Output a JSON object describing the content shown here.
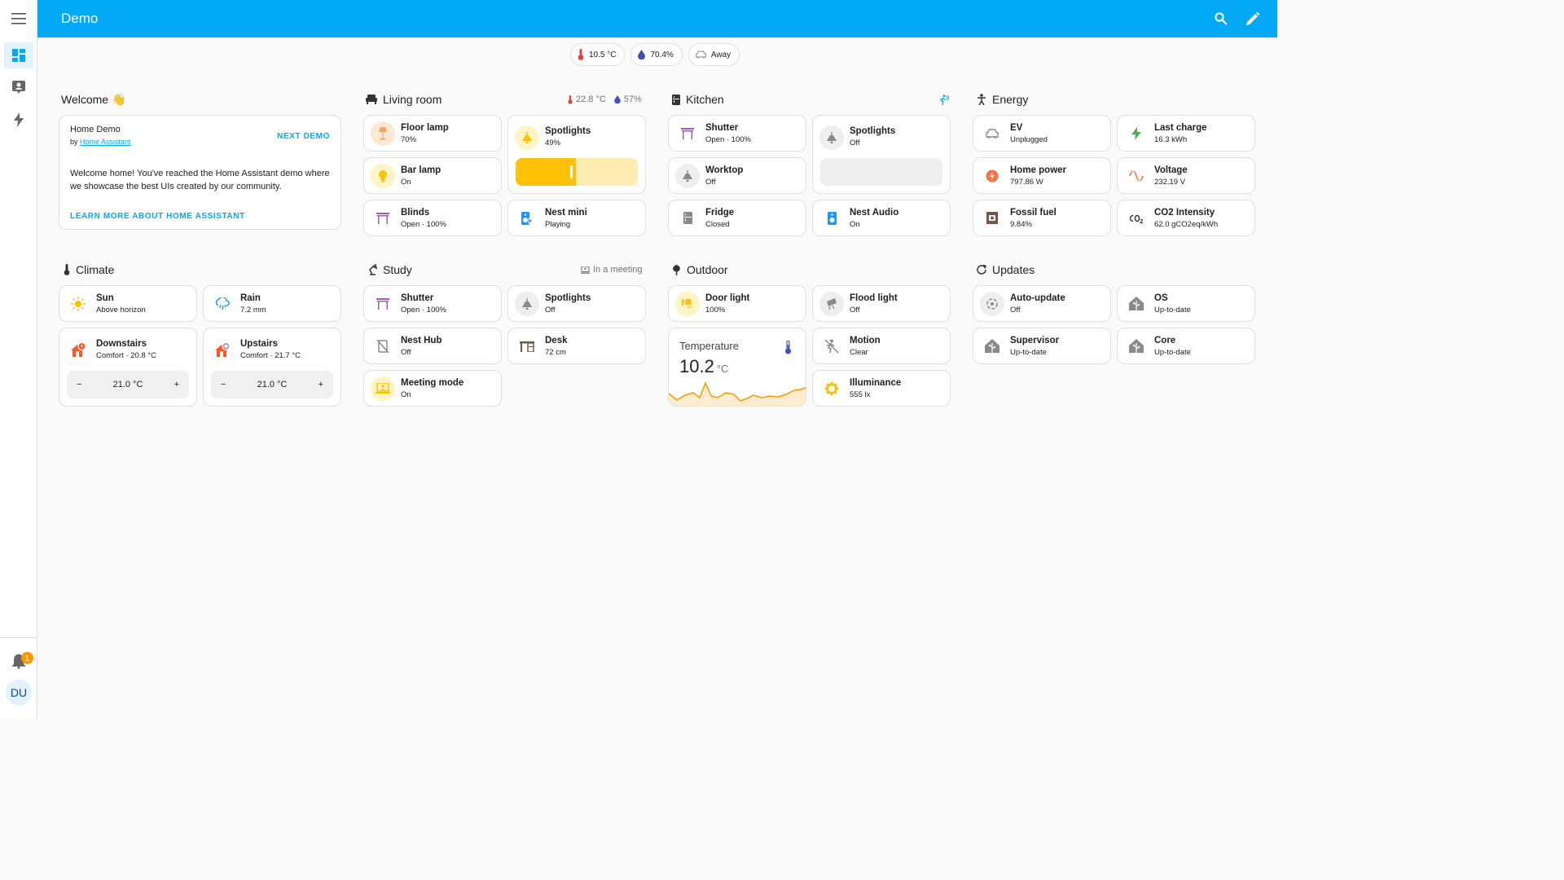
{
  "app": {
    "title": "Demo"
  },
  "sidebar": {
    "user_initials": "DU",
    "notification_count": "1"
  },
  "badges": [
    {
      "label": "10.5 °C",
      "icon": "thermometer-icon",
      "color": "#db4437"
    },
    {
      "label": "70.4%",
      "icon": "water-percent-icon",
      "color": "#3f51b5"
    },
    {
      "label": "Away",
      "icon": "car-icon",
      "color": "#9e9e9e"
    }
  ],
  "sections": {
    "welcome": {
      "title": "Welcome 👋"
    },
    "living_room": {
      "title": "Living room",
      "temp": "22.8 °C",
      "humidity": "57%"
    },
    "kitchen": {
      "title": "Kitchen"
    },
    "energy": {
      "title": "Energy"
    },
    "climate": {
      "title": "Climate"
    },
    "study": {
      "title": "Study",
      "status": "In a meeting"
    },
    "outdoor": {
      "title": "Outdoor"
    },
    "updates": {
      "title": "Updates"
    }
  },
  "welcome_card": {
    "title": "Home Demo",
    "by": "by ",
    "author": "Home Assistant",
    "next_demo": "NEXT DEMO",
    "body": "Welcome home! You've reached the Home Assistant demo where we showcase the best UIs created by our community.",
    "learn_more": "LEARN MORE ABOUT HOME ASSISTANT"
  },
  "living_room": {
    "floor_lamp": {
      "name": "Floor lamp",
      "state": "70%"
    },
    "spotlights": {
      "name": "Spotlights",
      "state": "49%",
      "level": 0.49
    },
    "bar_lamp": {
      "name": "Bar lamp",
      "state": "On"
    },
    "blinds": {
      "name": "Blinds",
      "state": "Open · 100%"
    },
    "nest_mini": {
      "name": "Nest mini",
      "state": "Playing"
    }
  },
  "kitchen": {
    "shutter": {
      "name": "Shutter",
      "state": "Open · 100%"
    },
    "spotlights": {
      "name": "Spotlights",
      "state": "Off"
    },
    "worktop": {
      "name": "Worktop",
      "state": "Off"
    },
    "fridge": {
      "name": "Fridge",
      "state": "Closed"
    },
    "nest_audio": {
      "name": "Nest Audio",
      "state": "On"
    }
  },
  "energy": {
    "ev": {
      "name": "EV",
      "state": "Unplugged"
    },
    "last_charge": {
      "name": "Last charge",
      "state": "16.3 kWh"
    },
    "home_power": {
      "name": "Home power",
      "state": "797.86 W"
    },
    "voltage": {
      "name": "Voltage",
      "state": "232.19 V"
    },
    "fossil_fuel": {
      "name": "Fossil fuel",
      "state": "9.84%"
    },
    "co2": {
      "name": "CO2 Intensity",
      "state": "62.0 gCO2eq/kWh"
    }
  },
  "climate": {
    "sun": {
      "name": "Sun",
      "state": "Above horizon"
    },
    "rain": {
      "name": "Rain",
      "state": "7.2 mm"
    },
    "downstairs": {
      "name": "Downstairs",
      "state": "Comfort · 20.8 °C",
      "target": "21.0 °C"
    },
    "upstairs": {
      "name": "Upstairs",
      "state": "Comfort · 21.7 °C",
      "target": "21.0 °C"
    }
  },
  "study": {
    "shutter": {
      "name": "Shutter",
      "state": "Open · 100%"
    },
    "spotlights": {
      "name": "Spotlights",
      "state": "Off"
    },
    "nest_hub": {
      "name": "Nest Hub",
      "state": "Off"
    },
    "desk": {
      "name": "Desk",
      "state": "72 cm"
    },
    "meeting_mode": {
      "name": "Meeting mode",
      "state": "On"
    }
  },
  "outdoor": {
    "door_light": {
      "name": "Door light",
      "state": "100%"
    },
    "flood_light": {
      "name": "Flood light",
      "state": "Off"
    },
    "temperature": {
      "label": "Temperature",
      "value": "10.2",
      "unit": "°C"
    },
    "motion": {
      "name": "Motion",
      "state": "Clear"
    },
    "illuminance": {
      "name": "Illuminance",
      "state": "555 lx"
    }
  },
  "updates": {
    "auto_update": {
      "name": "Auto-update",
      "state": "Off"
    },
    "os": {
      "name": "OS",
      "state": "Up-to-date"
    },
    "supervisor": {
      "name": "Supervisor",
      "state": "Up-to-date"
    },
    "core": {
      "name": "Core",
      "state": "Up-to-date"
    }
  },
  "colors": {
    "primary": "#03a9f4",
    "light": "#ffc107",
    "cover": "#9c5fb0",
    "energy": "#ff7043"
  }
}
